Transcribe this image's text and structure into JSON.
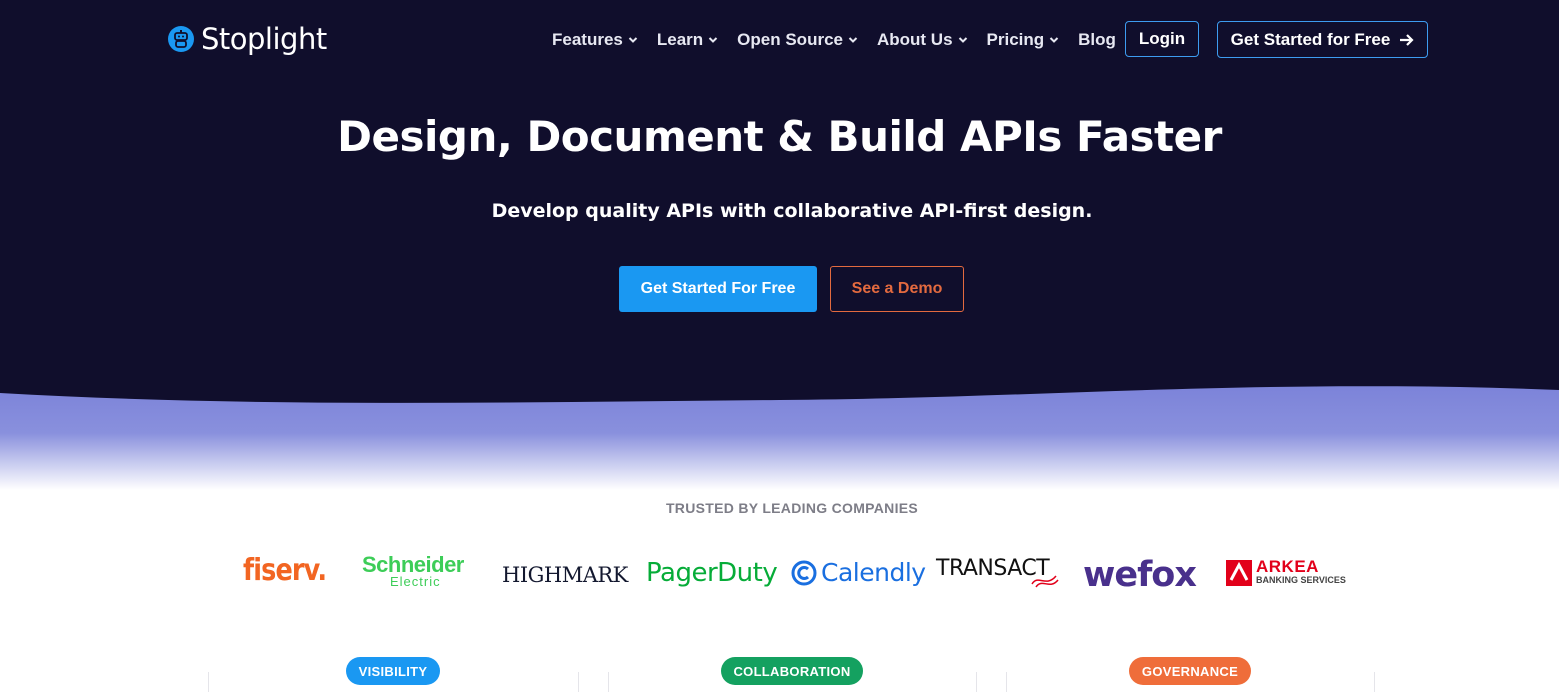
{
  "brand": {
    "name": "Stoplight",
    "logo_icon": "robot-icon",
    "accent": "#1a98f2"
  },
  "nav": {
    "items": [
      {
        "label": "Features",
        "has_menu": true
      },
      {
        "label": "Learn",
        "has_menu": true
      },
      {
        "label": "Open Source",
        "has_menu": true
      },
      {
        "label": "About Us",
        "has_menu": true
      },
      {
        "label": "Pricing",
        "has_menu": true
      },
      {
        "label": "Blog",
        "has_menu": false
      }
    ],
    "login_label": "Login",
    "cta_label": "Get Started for Free"
  },
  "hero": {
    "headline": "Design, Document & Build APIs Faster",
    "subhead": "Develop quality APIs with collaborative API-first design.",
    "primary_cta": "Get Started For Free",
    "secondary_cta": "See a Demo",
    "background": "#100e2c"
  },
  "trusted": {
    "heading": "TRUSTED BY LEADING COMPANIES",
    "logos": {
      "fiserv": "fiserv.",
      "schneider_1": "Schneider",
      "schneider_2": "Electric",
      "highmark": "HIGHMARK",
      "pagerduty": "PagerDuty",
      "calendly": "Calendly",
      "transact": "TRANSACT",
      "wefox": "wefox",
      "arkea_1": "ARKEA",
      "arkea_2": "BANKING SERVICES"
    }
  },
  "features": {
    "pills": [
      {
        "label": "VISIBILITY",
        "color": "#1a98f2"
      },
      {
        "label": "COLLABORATION",
        "color": "#14a160"
      },
      {
        "label": "GOVERNANCE",
        "color": "#ef6d3a"
      }
    ]
  }
}
